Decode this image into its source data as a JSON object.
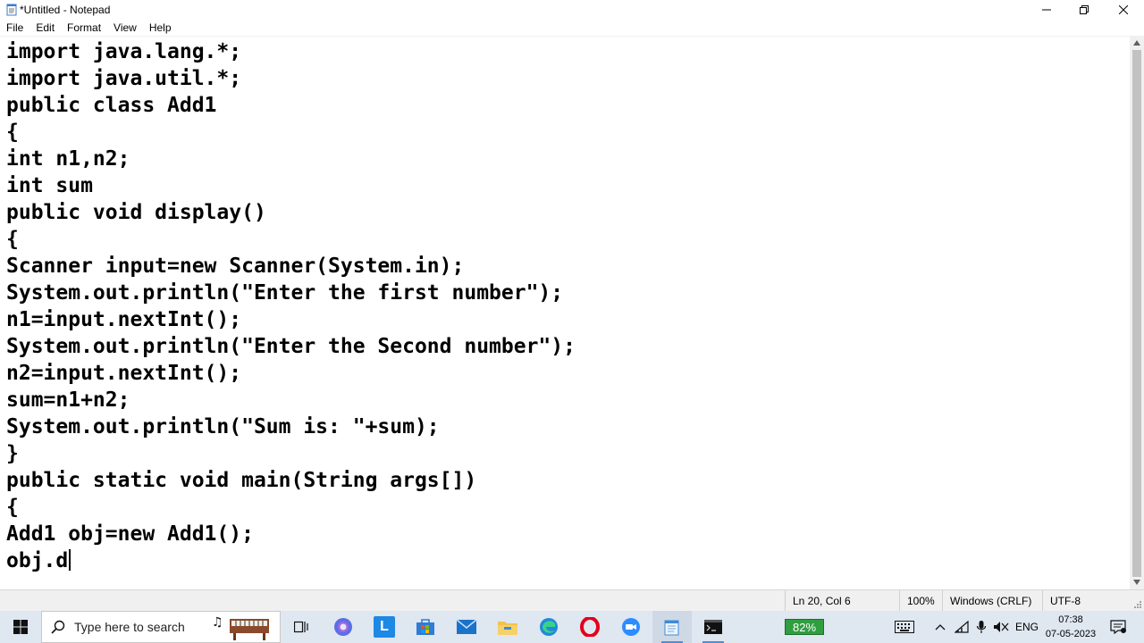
{
  "window": {
    "title": "*Untitled - Notepad"
  },
  "menu": [
    {
      "label": "File"
    },
    {
      "label": "Edit"
    },
    {
      "label": "Format"
    },
    {
      "label": "View"
    },
    {
      "label": "Help"
    }
  ],
  "editor": {
    "lines": [
      "import java.lang.*;",
      "import java.util.*;",
      "public class Add1",
      "{",
      "int n1,n2;",
      "int sum",
      "public void display()",
      "{",
      "Scanner input=new Scanner(System.in);",
      "System.out.println(\"Enter the first number\");",
      "n1=input.nextInt();",
      "System.out.println(\"Enter the Second number\");",
      "n2=input.nextInt();",
      "sum=n1+n2;",
      "System.out.println(\"Sum is: \"+sum);",
      "}",
      "public static void main(String args[])",
      "{",
      "Add1 obj=new Add1();",
      "obj.d"
    ]
  },
  "status": {
    "position": "Ln 20, Col 6",
    "zoom": "100%",
    "line_ending": "Windows (CRLF)",
    "encoding": "UTF-8"
  },
  "taskbar": {
    "search_placeholder": "Type here to search",
    "apps": [
      {
        "icon": "task-view-icon"
      },
      {
        "icon": "chrome-like-icon"
      },
      {
        "icon": "l-app-icon",
        "label": "L"
      },
      {
        "icon": "store-icon"
      },
      {
        "icon": "mail-icon"
      },
      {
        "icon": "file-explorer-icon"
      },
      {
        "icon": "edge-icon"
      },
      {
        "icon": "opera-icon"
      },
      {
        "icon": "zoom-icon"
      },
      {
        "icon": "notepad-icon"
      },
      {
        "icon": "terminal-icon"
      }
    ],
    "battery": "82%",
    "language": "ENG",
    "time": "07:38",
    "date": "07-05-2023"
  },
  "colors": {
    "taskbar_bg": "#dfe7f1",
    "battery_green": "#2f9e3f",
    "accent": "#0078d4"
  }
}
